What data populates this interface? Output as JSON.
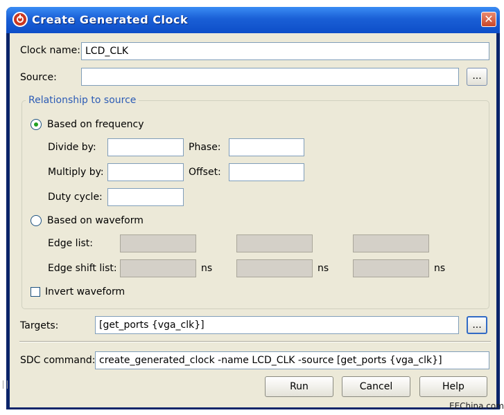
{
  "window": {
    "title": "Create Generated Clock",
    "close_glyph": "✕"
  },
  "clock_name": {
    "label": "Clock name:",
    "value": "LCD_CLK"
  },
  "source": {
    "label": "Source:",
    "value": "",
    "browse_label": "..."
  },
  "relationship": {
    "title": "Relationship to source",
    "freq_option": {
      "label": "Based on frequency",
      "checked": true
    },
    "divide_by": {
      "label": "Divide by:",
      "value": ""
    },
    "phase": {
      "label": "Phase:",
      "value": ""
    },
    "multiply_by": {
      "label": "Multiply by:",
      "value": ""
    },
    "offset": {
      "label": "Offset:",
      "value": ""
    },
    "duty_cycle": {
      "label": "Duty cycle:",
      "value": ""
    },
    "waveform_option": {
      "label": "Based on waveform",
      "checked": false
    },
    "edge_list": {
      "label": "Edge list:",
      "values": [
        "",
        "",
        ""
      ]
    },
    "edge_shift_list": {
      "label": "Edge shift list:",
      "values": [
        "",
        "",
        ""
      ],
      "unit": "ns"
    },
    "invert_waveform": {
      "label": "Invert waveform",
      "checked": false
    }
  },
  "targets": {
    "label": "Targets:",
    "value": "[get_ports {vga_clk}]",
    "browse_label": "..."
  },
  "sdc": {
    "label": "SDC command:",
    "value": "create_generated_clock -name LCD_CLK -source  [get_ports {vga_clk}]"
  },
  "buttons": {
    "run": "Run",
    "cancel": "Cancel",
    "help": "Help"
  },
  "watermark": "EEChina.com"
}
